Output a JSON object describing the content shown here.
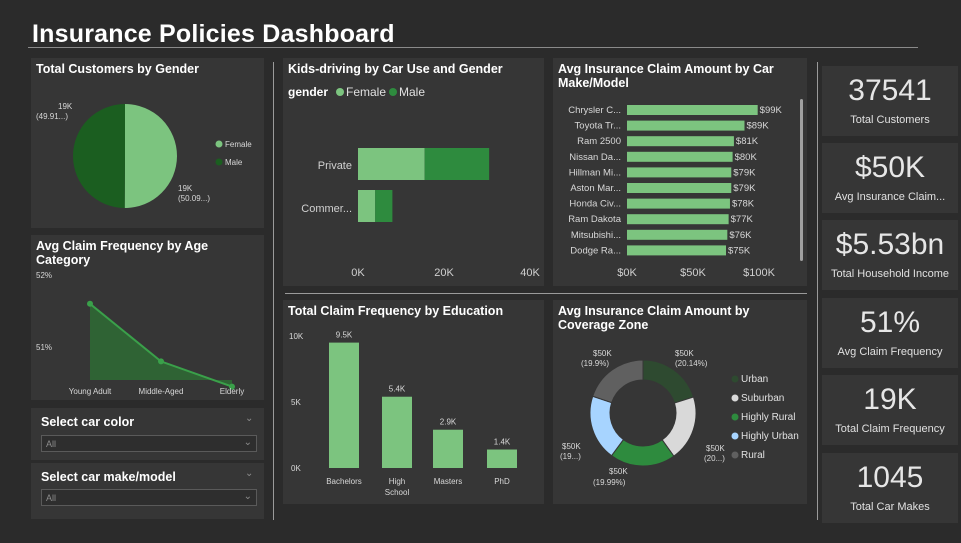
{
  "title": "Insurance Policies Dashboard",
  "colors": {
    "background": "#2b2b2b",
    "panel": "#363636",
    "light_green": "#7cc47f",
    "dark_green": "#1b5e20",
    "mid_green": "#2e8b3e",
    "light_blue": "#a7d4ff",
    "light_gray": "#d9d9d9",
    "dark_gray": "#606060"
  },
  "gender_panel": {
    "title": "Total Customers by Gender",
    "chart_data": {
      "type": "pie",
      "categories": [
        "Female",
        "Male"
      ],
      "values": [
        50.09,
        49.91
      ],
      "labels": [
        {
          "line1": "19K",
          "line2": "(50.09...)"
        },
        {
          "line1": "19K",
          "line2": "(49.91...)"
        }
      ],
      "legend": [
        "Female",
        "Male"
      ]
    }
  },
  "age_panel": {
    "title": "Avg Claim Frequency by Age Category",
    "chart_data": {
      "type": "area",
      "categories": [
        "Young Adult",
        "Middle-Aged",
        "Elderly"
      ],
      "values": [
        51.6,
        50.8,
        50.45
      ],
      "ylim": [
        50.0,
        52.0
      ],
      "yticks": [
        "52%",
        "51%"
      ]
    }
  },
  "slicers": [
    {
      "title": "Select car color",
      "value": "All"
    },
    {
      "title": "Select car make/model",
      "value": "All"
    }
  ],
  "kids_panel": {
    "title": "Kids-driving by Car Use and Gender",
    "legend_title": "gender",
    "chart_data": {
      "type": "bar",
      "orientation": "horizontal",
      "stacked": true,
      "categories": [
        "Private",
        "Commer..."
      ],
      "series": [
        {
          "name": "Female",
          "values": [
            15500,
            4000
          ]
        },
        {
          "name": "Male",
          "values": [
            15000,
            4000
          ]
        }
      ],
      "xlim": [
        0,
        40000
      ],
      "xticks": [
        "0K",
        "20K",
        "40K"
      ]
    }
  },
  "make_panel": {
    "title": "Avg Insurance Claim Amount by Car Make/Model",
    "chart_data": {
      "type": "bar",
      "orientation": "horizontal",
      "categories": [
        "Chrysler C...",
        "Toyota Tr...",
        "Ram 2500",
        "Nissan Da...",
        "Hillman Mi...",
        "Aston Mar...",
        "Honda Civ...",
        "Ram Dakota",
        "Mitsubishi...",
        "Dodge Ra..."
      ],
      "values": [
        99,
        89,
        81,
        80,
        79,
        79,
        78,
        77,
        76,
        75
      ],
      "value_labels": [
        "$99K",
        "$89K",
        "$81K",
        "$80K",
        "$79K",
        "$79K",
        "$78K",
        "$77K",
        "$76K",
        "$75K"
      ],
      "xlim": [
        0,
        100
      ],
      "xticks": [
        "$0K",
        "$50K",
        "$100K"
      ]
    }
  },
  "education_panel": {
    "title": "Total Claim Frequency by Education",
    "chart_data": {
      "type": "bar",
      "categories": [
        "Bachelors",
        "High School",
        "Masters",
        "PhD"
      ],
      "category_lines": [
        [
          "Bachelors"
        ],
        [
          "High",
          "School"
        ],
        [
          "Masters"
        ],
        [
          "PhD"
        ]
      ],
      "values": [
        9.5,
        5.4,
        2.9,
        1.4
      ],
      "value_labels": [
        "9.5K",
        "5.4K",
        "2.9K",
        "1.4K"
      ],
      "ylim": [
        0,
        10
      ],
      "yticks": [
        "10K",
        "5K",
        "0K"
      ]
    }
  },
  "zone_panel": {
    "title": "Avg Insurance Claim Amount by Coverage Zone",
    "chart_data": {
      "type": "pie",
      "donut": true,
      "categories": [
        "Urban",
        "Suburban",
        "Highly Rural",
        "Highly Urban",
        "Rural"
      ],
      "values": [
        20.14,
        20.0,
        19.99,
        20.0,
        19.9
      ],
      "labels": [
        {
          "line1": "$50K",
          "line2": "(20.14%)"
        },
        {
          "line1": "$50K",
          "line2": "(20...)"
        },
        {
          "line1": "$50K",
          "line2": "(19.99%)"
        },
        {
          "line1": "$50K",
          "line2": "(19...)"
        },
        {
          "line1": "$50K",
          "line2": "(19.9%)"
        }
      ],
      "legend": [
        "Urban",
        "Suburban",
        "Highly Rural",
        "Highly Urban",
        "Rural"
      ]
    }
  },
  "cards": [
    {
      "value": "37541",
      "label": "Total Customers"
    },
    {
      "value": "$50K",
      "label": "Avg Insurance Claim..."
    },
    {
      "value": "$5.53bn",
      "label": "Total Household Income"
    },
    {
      "value": "51%",
      "label": "Avg Claim Frequency"
    },
    {
      "value": "19K",
      "label": "Total Claim Frequency"
    },
    {
      "value": "1045",
      "label": "Total Car Makes"
    }
  ]
}
